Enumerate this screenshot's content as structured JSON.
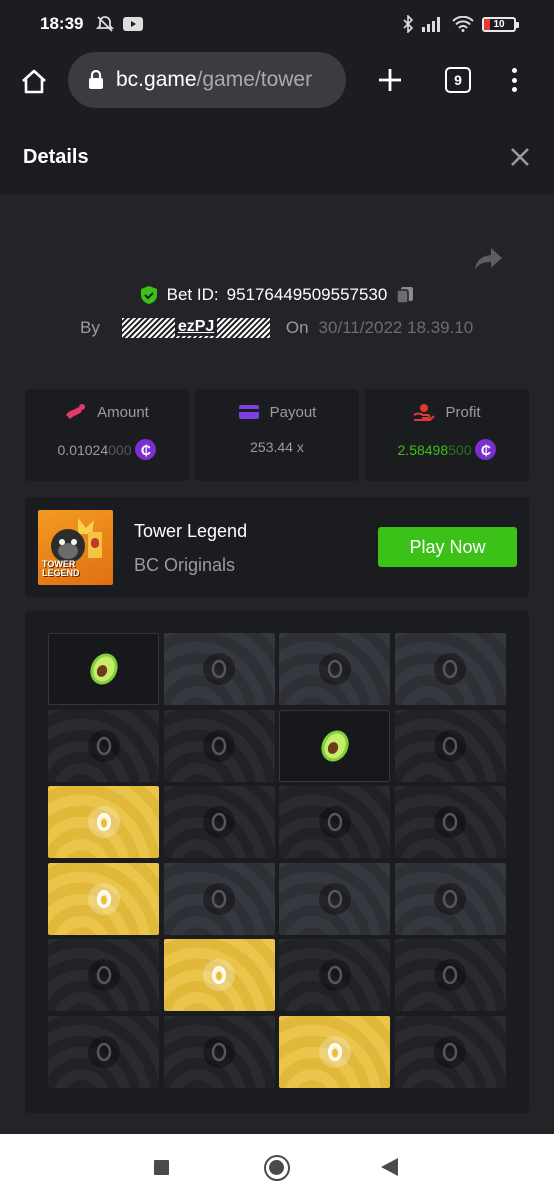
{
  "status_bar": {
    "time": "18:39",
    "battery": "10"
  },
  "browser": {
    "url_domain": "bc.game",
    "url_path": "/game/tower",
    "tab_count": "9"
  },
  "details": {
    "title": "Details"
  },
  "bet": {
    "label": "Bet ID:",
    "id": "95176449509557530",
    "by_label": "By",
    "user_visible": "ezPJ",
    "on_label": "On",
    "date": "30/11/2022 18.39.10"
  },
  "stats": {
    "amount": {
      "label": "Amount",
      "value_main": "0.01024",
      "value_dim": "000",
      "coin": "₵"
    },
    "payout": {
      "label": "Payout",
      "value": "253.44 x"
    },
    "profit": {
      "label": "Profit",
      "value_main": "2.58498",
      "value_dim": "500",
      "coin": "₵"
    }
  },
  "game": {
    "name": "Tower Legend",
    "provider": "BC Originals",
    "play_label": "Play Now",
    "thumb_text_1": "TOWER",
    "thumb_text_2": "LEGEND"
  },
  "board": {
    "rows": [
      [
        "revealed-avocado",
        "grey",
        "grey",
        "grey"
      ],
      [
        "dark",
        "dark",
        "revealed-avocado",
        "dark"
      ],
      [
        "gold",
        "dark",
        "dark",
        "dark"
      ],
      [
        "gold",
        "grey",
        "grey",
        "grey"
      ],
      [
        "dark",
        "gold",
        "dark",
        "dark"
      ],
      [
        "dark",
        "dark",
        "gold",
        "dark"
      ]
    ]
  },
  "colors": {
    "accent_green": "#3bc117",
    "coin_purple": "#7a2fd1",
    "gold_tile": "#e8bf3c",
    "amount_icon": "#e03a6d",
    "payout_icon": "#7b3fe4",
    "profit_icon": "#e0392f"
  },
  "icons": {
    "status": [
      "mute-icon",
      "youtube-icon",
      "bluetooth-icon",
      "signal-icon",
      "wifi-icon",
      "battery-icon"
    ],
    "shield": "shield-check-icon",
    "copy": "copy-icon",
    "share": "share-icon"
  }
}
